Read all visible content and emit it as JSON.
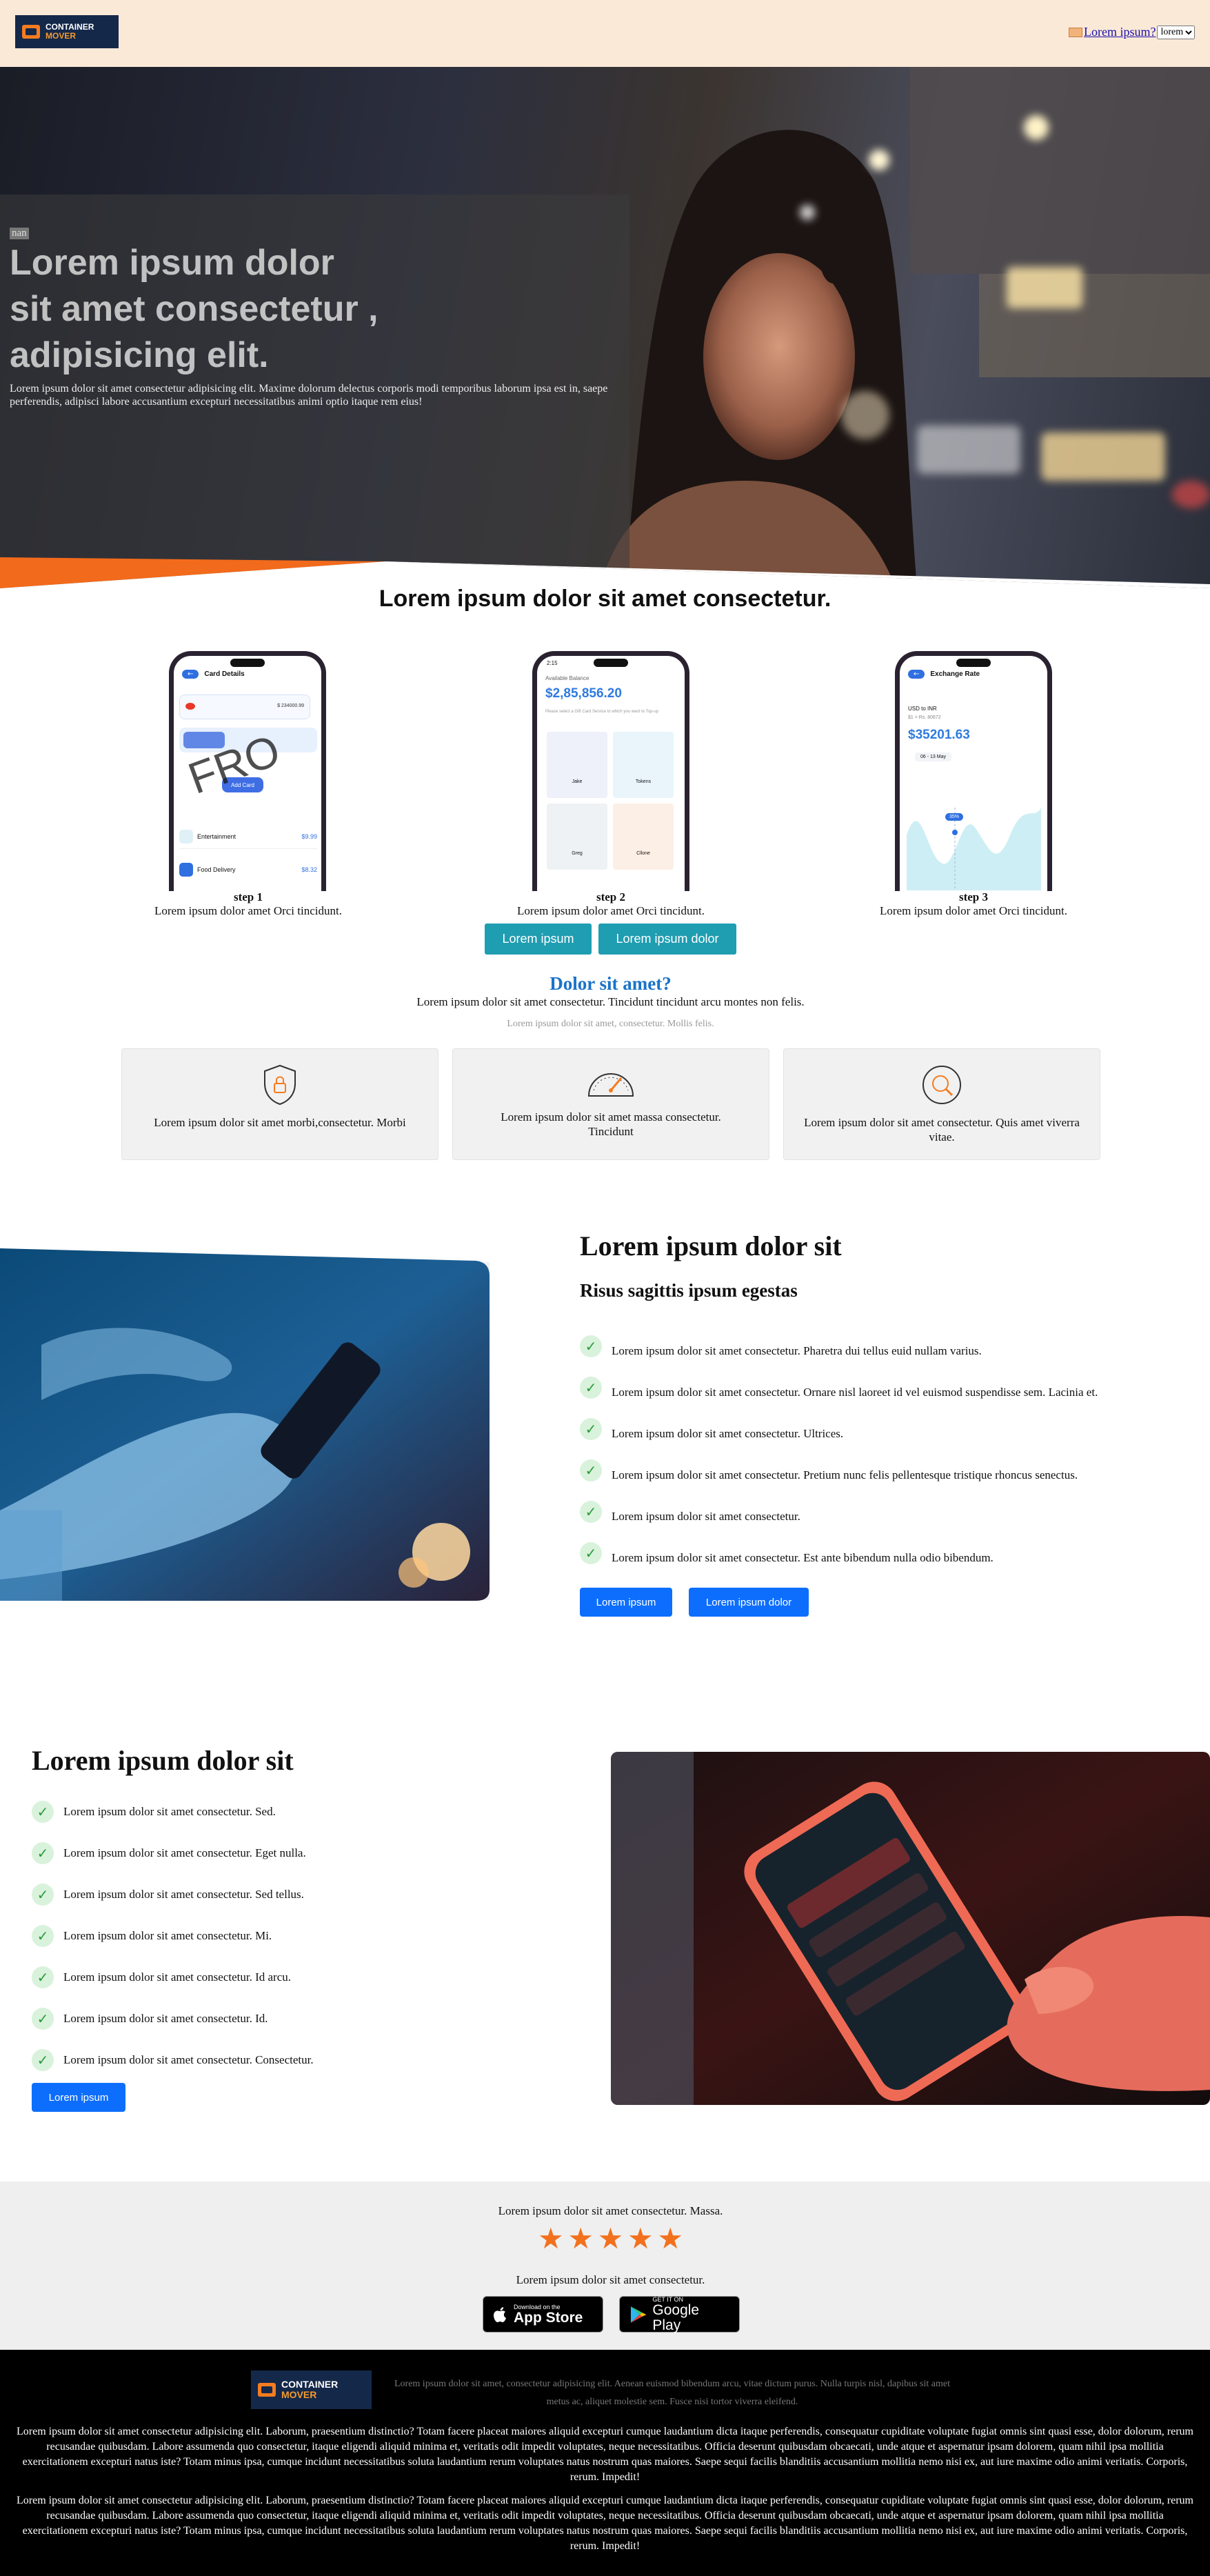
{
  "header": {
    "logo": {
      "line1": "CONTAINER",
      "line2": "MOVER"
    },
    "nav_link": "Lorem ipsum?",
    "select_value": "lorem"
  },
  "hero": {
    "badge": "nan",
    "title_line1": "Lorem ipsum dolor",
    "title_line2": "sit amet consectetur ,",
    "title_line3": "adipisicing elit.",
    "subtitle": "Lorem ipsum dolor sit amet consectetur adipisicing elit. Maxime dolorum delectus corporis modi temporibus laborum ipsa est in, saepe perferendis, adipisci labore accusantium excepturi necessitatibus animi optio itaque rem eius!"
  },
  "steps_section": {
    "heading": "Lorem ipsum dolor sit amet consectetur.",
    "steps": [
      {
        "label": "step 1",
        "text": "Lorem ipsum dolor amet Orci tincidunt."
      },
      {
        "label": "step 2",
        "text": "Lorem ipsum dolor amet Orci tincidunt."
      },
      {
        "label": "step 3",
        "text": "Lorem ipsum dolor amet Orci tincidunt."
      }
    ],
    "phone1": {
      "title": "Card Details",
      "amount": "$ 234000.99",
      "add": "Add Card",
      "list1": "Entertainment",
      "list1_amt": "$9.99",
      "list2": "Food Delivery",
      "list2_amt": "$8.32",
      "watermark": "FRO"
    },
    "phone2": {
      "time": "2:15",
      "label": "Available Balance",
      "amount": "$2,85,856.20",
      "note": "Please select a Gift Card Service to which you want to Top-up",
      "cells": [
        "Jake",
        "Tokens",
        "Greg",
        "Cllone"
      ]
    },
    "phone3": {
      "title": "Exchange Rate",
      "pair": "USD to INR",
      "rate": "$1 = Rs. 80672",
      "amount": "$35201.63",
      "range": "06 - 13 May",
      "tag": "35%"
    },
    "buttons": [
      "Lorem ipsum",
      "Lorem ipsum dolor"
    ]
  },
  "about": {
    "heading": "Dolor sit amet?",
    "lead": "Lorem ipsum dolor sit amet consectetur. Tincidunt tincidunt arcu montes non felis.",
    "note": "Lorem ipsum dolor sit amet, consectetur. Mollis felis.",
    "cards": [
      {
        "icon": "shield-lock-icon",
        "text": "Lorem ipsum dolor sit amet morbi,consectetur. Morbi"
      },
      {
        "icon": "gauge-icon",
        "text": "Lorem ipsum dolor sit amet massa consectetur. Tincidunt"
      },
      {
        "icon": "search-icon",
        "text": "Lorem ipsum dolor sit amet consectetur. Quis amet viverra vitae."
      }
    ]
  },
  "feature1": {
    "title": "Lorem ipsum dolor sit",
    "subtitle": "Risus sagittis ipsum egestas",
    "items": [
      "Lorem ipsum dolor sit amet consectetur. Pharetra dui tellus euid nullam varius.",
      "Lorem ipsum dolor sit amet consectetur. Ornare nisl laoreet id vel euismod suspendisse sem. Lacinia et.",
      "Lorem ipsum dolor sit amet consectetur. Ultrices.",
      "Lorem ipsum dolor sit amet consectetur. Pretium nunc felis pellentesque tristique rhoncus senectus.",
      "Lorem ipsum dolor sit amet consectetur.",
      "Lorem ipsum dolor sit amet consectetur. Est ante bibendum nulla odio bibendum."
    ],
    "buttons": [
      "Lorem ipsum",
      "Lorem ipsum dolor"
    ]
  },
  "feature2": {
    "title": "Lorem ipsum dolor sit",
    "items": [
      "Lorem ipsum dolor sit amet consectetur. Sed.",
      "Lorem ipsum dolor sit amet consectetur. Eget nulla.",
      "Lorem ipsum dolor sit amet consectetur. Sed tellus.",
      "Lorem ipsum dolor sit amet consectetur. Mi.",
      "Lorem ipsum dolor sit amet consectetur. Id arcu.",
      "Lorem ipsum dolor sit amet consectetur. Id.",
      "Lorem ipsum dolor sit amet consectetur. Consectetur."
    ],
    "button": "Lorem ipsum"
  },
  "rating": {
    "text": "Lorem ipsum dolor sit amet consectetur. Massa.",
    "stars": 5,
    "download_text": "Lorem ipsum dolor sit amet consectetur.",
    "appstore": {
      "small": "Download on the",
      "big": "App Store"
    },
    "googleplay": {
      "small": "GET IT ON",
      "big": "Google Play"
    }
  },
  "footer": {
    "tagline": "Lorem ipsum dolor sit amet, consectetur adipisicing elit. Aenean euismod bibendum arcu, vitae dictum purus. Nulla turpis nisl, dapibus sit amet metus ac, aliquet molestie sem. Fusce nisi tortor viverra eleifend.",
    "para1": "Lorem ipsum dolor sit amet consectetur adipisicing elit. Laborum, praesentium distinctio? Totam facere placeat maiores aliquid excepturi cumque laudantium dicta itaque perferendis, consequatur cupiditate voluptate fugiat omnis sint quasi esse, dolor dolorum, rerum recusandae quibusdam. Labore assumenda quo consectetur, itaque eligendi aliquid minima et, veritatis odit impedit voluptates, neque necessitatibus. Officia deserunt quibusdam obcaecati, unde atque et aspernatur ipsam dolorem, quam nihil ipsa mollitia exercitationem excepturi natus iste? Totam minus ipsa, cumque incidunt necessitatibus soluta laudantium rerum voluptates natus nostrum quas maiores. Saepe sequi facilis blanditiis accusantium mollitia nemo nisi ex, aut iure maxime odio animi veritatis. Corporis, rerum. Impedit!",
    "para2": "Lorem ipsum dolor sit amet consectetur adipisicing elit. Laborum, praesentium distinctio? Totam facere placeat maiores aliquid excepturi cumque laudantium dicta itaque perferendis, consequatur cupiditate voluptate fugiat omnis sint quasi esse, dolor dolorum, rerum recusandae quibusdam. Labore assumenda quo consectetur, itaque eligendi aliquid minima et, veritatis odit impedit voluptates, neque necessitatibus. Officia deserunt quibusdam obcaecati, unde atque et aspernatur ipsam dolorem, quam nihil ipsa mollitia exercitationem excepturi natus iste? Totam minus ipsa, cumque incidunt necessitatibus soluta laudantium rerum voluptates natus nostrum quas maiores. Saepe sequi facilis blanditiis accusantium mollitia nemo nisi ex, aut iure maxime odio animi veritatis. Corporis, rerum. Impedit!"
  },
  "colors": {
    "header_bg": "#fbe9d8",
    "accent_orange": "#f47c20",
    "teal_button": "#1f9db1",
    "blue_button": "#0d6efd",
    "heading_blue": "#1a73c8",
    "rating_bg": "#efefef",
    "footer_bg": "#000000"
  }
}
